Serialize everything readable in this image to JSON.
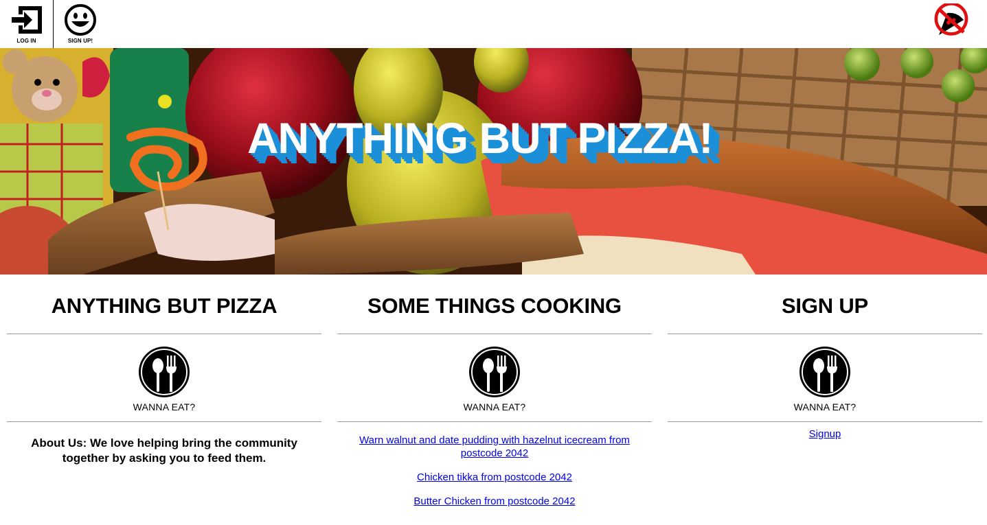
{
  "nav": {
    "login_label": "LOG IN",
    "signup_label": "SIGN UP!"
  },
  "hero": {
    "title": "ANYTHING BUT PIZZA!"
  },
  "columns": [
    {
      "title": "ANYTHING BUT PIZZA",
      "icon_caption": "WANNA EAT?",
      "about": "About Us: We love helping bring the community together by asking you to feed them."
    },
    {
      "title": "SOME THINGS COOKING",
      "icon_caption": "WANNA EAT?",
      "links": [
        "Warn walnut and date pudding with hazelnut icecream from postcode 2042",
        "Chicken tikka from postcode 2042",
        "Butter Chicken from postcode 2042"
      ]
    },
    {
      "title": "SIGN UP",
      "icon_caption": "WANNA EAT?",
      "link": "Signup"
    }
  ],
  "icons": {
    "login": "login-icon",
    "signup": "smiley-icon",
    "brand": "no-pizza-icon",
    "food": "spoon-fork-icon"
  },
  "colors": {
    "hero_shadow": "#1b8fd8",
    "link": "#0000ee",
    "no_sign_red": "#e01010"
  }
}
